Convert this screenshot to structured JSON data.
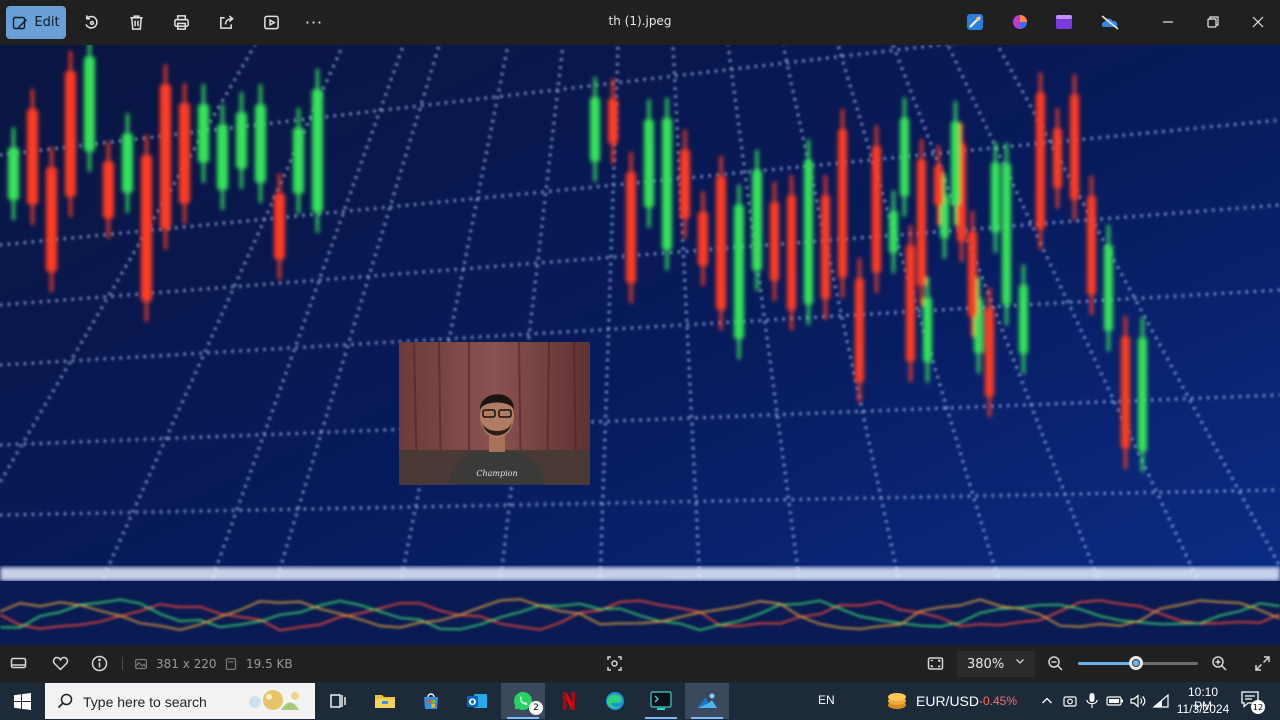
{
  "toolbar": {
    "edit_label": "Edit",
    "more_label": "···",
    "window_title": "th (1).jpeg"
  },
  "statusbar": {
    "dimensions": "381 x 220",
    "file_size": "19.5 KB",
    "zoom_value": "380%",
    "zoom_level_percent": 48
  },
  "taskbar": {
    "search_placeholder": "Type here to search",
    "whatsapp_badge": "2",
    "language": "EN",
    "ticker_symbol": "EUR/USD",
    "ticker_change": "-0.45%",
    "time": "10:10 PM",
    "date": "11/3/2024",
    "notification_count": "12"
  },
  "colors": {
    "accent": "#6aa0d8",
    "ticker_negative": "#ff6b6b",
    "chart_background": "#06103a",
    "candle_up": "#35e35a",
    "candle_down": "#ff3a24"
  }
}
